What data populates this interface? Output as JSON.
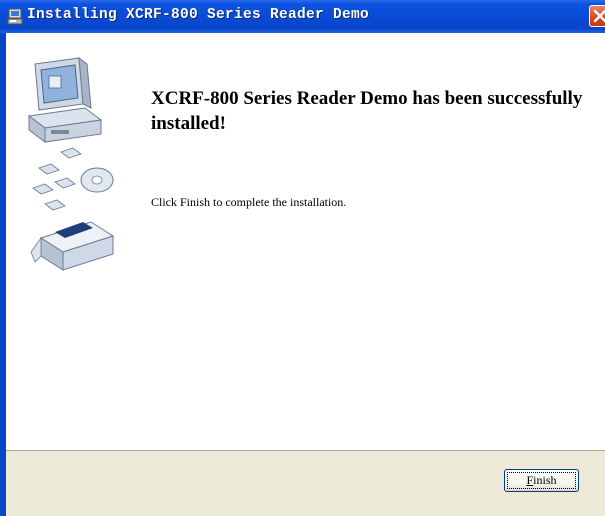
{
  "window": {
    "title": "Installing XCRF-800 Series Reader Demo",
    "title_icon": "installer-icon",
    "close_icon": "close-icon"
  },
  "content": {
    "heading": "XCRF-800 Series Reader Demo has been successfully installed!",
    "message": "Click Finish to complete the installation.",
    "illustration": "computer-install-illustration"
  },
  "footer": {
    "finish_mnemonic": "F",
    "finish_rest": "inish"
  },
  "colors": {
    "titlebar": "#0a4bd6",
    "footer": "#ece9d8",
    "close": "#d8461e"
  }
}
